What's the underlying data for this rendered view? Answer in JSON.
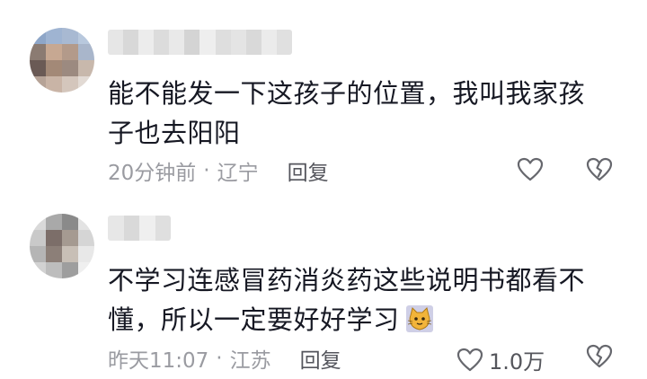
{
  "comments": [
    {
      "text_line1": "能不能发一下这孩子的位置，我叫我家孩",
      "text_line2": "子也去阳阳",
      "time": "20分钟前",
      "separator": "·",
      "location": "辽宁",
      "reply_label": "回复",
      "like_count": "",
      "avatar_colors": [
        "#8ea6c8",
        "#9fb4d2",
        "#a8b9d2",
        "#b8c8dd",
        "#8b7b72",
        "#c7a892",
        "#b39a8a",
        "#a9b6cb",
        "#6a5a55",
        "#a38977",
        "#9c8a80",
        "#c8b8ac",
        "#b6a397",
        "#c9b4a6",
        "#d4c6bc",
        "#e2dad4"
      ],
      "username_colors": [
        "#e6e6e6",
        "#d8d8d8",
        "#ececec",
        "#dcdcdc",
        "#e9e9e9",
        "#d4d4d4",
        "#eeeeee",
        "#dedede",
        "#e4e4e4",
        "#d9d9d9",
        "#ebebeb",
        "#e0e0e0"
      ]
    },
    {
      "text_line1": "不学习连感冒药消炎药这些说明书都看不",
      "text_line2": "懂，所以一定要好好学习",
      "time": "昨天11:07",
      "separator": "·",
      "location": "江苏",
      "reply_label": "回复",
      "like_count": "1.0万",
      "avatar_colors": [
        "#d9d9d9",
        "#a9a9a9",
        "#8a8a8a",
        "#e3e3e3",
        "#c9c9c9",
        "#7c6e69",
        "#a59a91",
        "#d5d5d5",
        "#b5b5b5",
        "#8c7f78",
        "#c8bfb6",
        "#e8e8e8",
        "#d2d2d2",
        "#bdbdbd",
        "#9e9e9e",
        "#efefef"
      ],
      "username_colors": [
        "#e7e7e7",
        "#d9d9d9",
        "#efefef",
        "#dfdfdf"
      ]
    }
  ],
  "icons": {
    "like": "heart-outline-icon",
    "dislike": "broken-heart-icon",
    "emoji": "cat-emoji-icon"
  }
}
